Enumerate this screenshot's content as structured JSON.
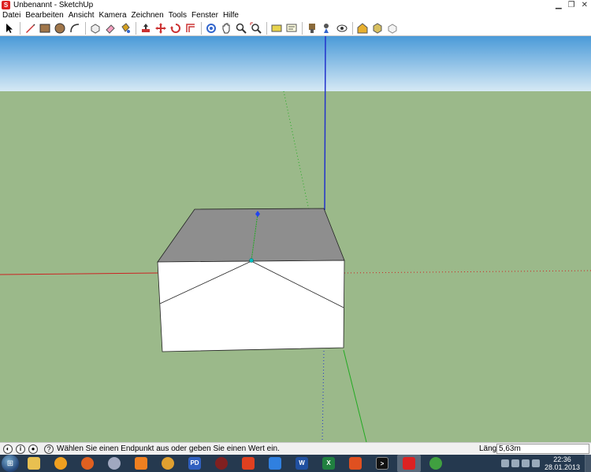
{
  "window": {
    "title": "Unbenannt - SketchUp",
    "app_icon": "sketchup-icon"
  },
  "menu": [
    "Datei",
    "Bearbeiten",
    "Ansicht",
    "Kamera",
    "Zeichnen",
    "Tools",
    "Fenster",
    "Hilfe"
  ],
  "toolbar": {
    "tools": [
      "select-arrow-icon",
      "separator",
      "pencil-line-icon",
      "rectangle-icon",
      "circle-icon",
      "arc-icon",
      "separator",
      "make-component-icon",
      "eraser-icon",
      "paint-bucket-icon",
      "separator",
      "push-pull-icon",
      "move-icon",
      "rotate-icon",
      "offset-icon",
      "separator",
      "orbit-icon",
      "pan-icon",
      "zoom-icon",
      "zoom-extents-icon",
      "separator",
      "tape-measure-icon",
      "text-icon",
      "separator",
      "walk-icon",
      "position-camera-icon",
      "look-around-icon",
      "separator",
      "warehouse-icon",
      "components-icon",
      "share-model-icon"
    ]
  },
  "colors": {
    "sky_top": "#4a9ad8",
    "sky_bottom": "#d6e9f5",
    "ground": "#9bb98a",
    "box_top": "#8e8e8e",
    "box_front": "#ffffff",
    "red_axis": "#cc2222",
    "green_axis": "#22aa22",
    "blue_axis": "#2233cc"
  },
  "status": {
    "message": "Wählen Sie einen Endpunkt aus oder geben Sie einen Wert ein.",
    "vcb_label": "Länge",
    "vcb_value": "5,63m",
    "help_icon": "help-icon",
    "geo_icon": "geolocation-icon",
    "credits_icon": "credits-icon"
  },
  "taskbar": {
    "apps": [
      "windows-explorer-icon",
      "browser-icon",
      "firefox-icon",
      "disc-icon",
      "vlc-icon",
      "network-icon",
      "powerdvd-icon",
      "media-icon",
      "file-manager-icon",
      "fastlane-icon",
      "word-icon",
      "excel-icon",
      "fox-icon",
      "cmd-icon",
      "sketchup-icon",
      "game-icon"
    ],
    "active_app": 14,
    "clock_time": "22:36",
    "clock_date": "28.01.2013"
  }
}
